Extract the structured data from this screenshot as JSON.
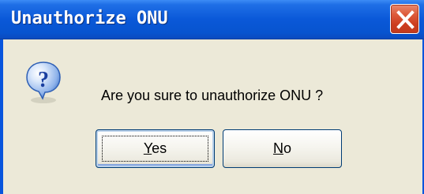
{
  "dialog": {
    "title": "Unauthorize ONU",
    "message": "Are you sure to unauthorize ONU ?",
    "icon": "question-icon",
    "buttons": {
      "yes": {
        "accel": "Y",
        "rest": "es"
      },
      "no": {
        "accel": "N",
        "rest": "o"
      }
    }
  },
  "colors": {
    "titlebar": "#0a58d8",
    "dialog_bg": "#ece9d8",
    "close_button": "#dd5a3a",
    "icon_blue": "#1f63d4"
  }
}
